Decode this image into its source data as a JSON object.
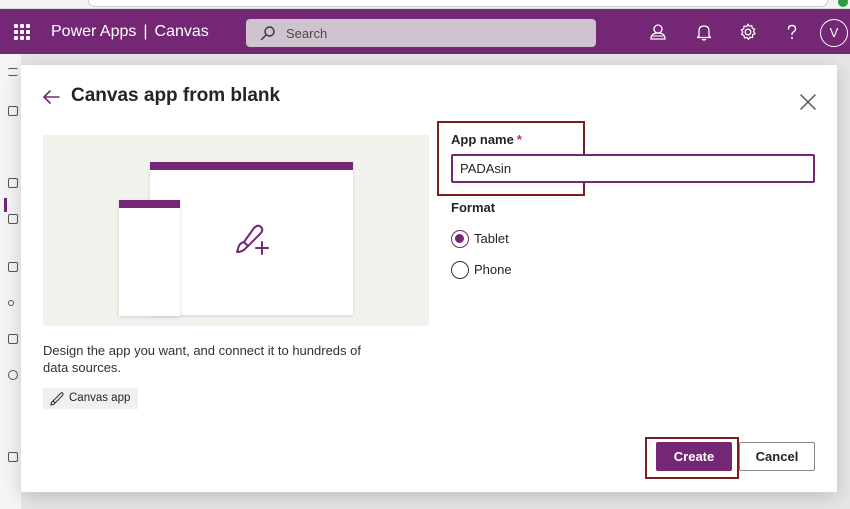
{
  "app": {
    "product": "Power Apps",
    "separator": "|",
    "section": "Canvas",
    "avatar_initial": "V"
  },
  "search": {
    "placeholder": "Search"
  },
  "header_icons": [
    "environment-icon",
    "bell-icon",
    "gear-icon",
    "help-icon"
  ],
  "dialog": {
    "title": "Canvas app from blank",
    "description": "Design the app you want, and connect it to hundreds of data sources.",
    "tag_label": "Canvas app",
    "app_name_label": "App name",
    "required_marker": "*",
    "app_name_value": "PADAsin",
    "format_label": "Format",
    "format_options": [
      {
        "label": "Tablet",
        "selected": true
      },
      {
        "label": "Phone",
        "selected": false
      }
    ],
    "create_label": "Create",
    "cancel_label": "Cancel"
  },
  "colors": {
    "brand": "#742774",
    "highlight_border": "#7b1b22",
    "required": "#c4314b"
  }
}
